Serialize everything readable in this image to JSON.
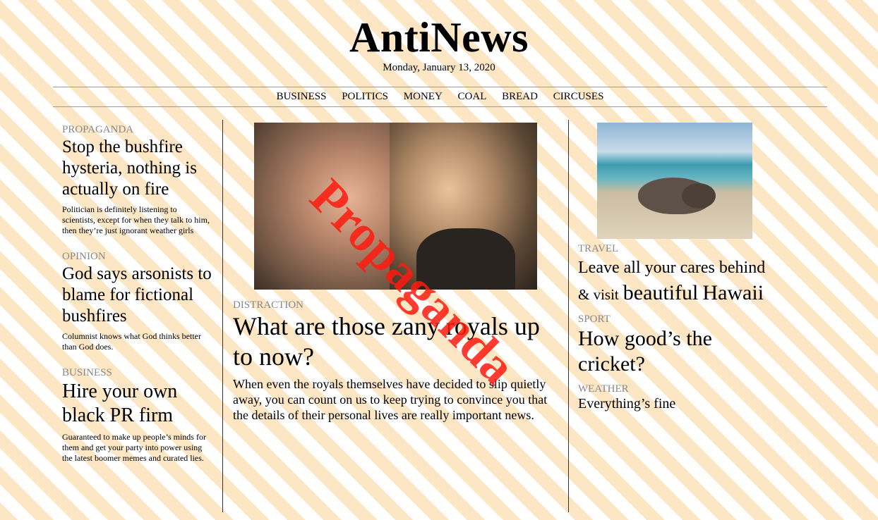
{
  "masthead": {
    "logo": "AntiNews",
    "date": "Monday, January 13, 2020"
  },
  "nav": [
    "BUSINESS",
    "POLITICS",
    "MONEY",
    "COAL",
    "BREAD",
    "CIRCUSES"
  ],
  "left": [
    {
      "section": "PROPAGANDA",
      "headline": "Stop the bushfire hysteria, nothing is actually on fire",
      "blurb": "Politician is definitely listening to scientists, except for when they talk to him, then they’re just ignorant weather girls"
    },
    {
      "section": "OPINION",
      "headline": "God says arsonists to blame for fictional bushfires",
      "blurb": "Columnist knows what God thinks better than God does."
    },
    {
      "section": "BUSINESS",
      "headline": "Hire your own black PR firm",
      "blurb": "Guaranteed to make up people’s minds for them and get your party into power using the latest boomer memes and curated lies."
    }
  ],
  "main": {
    "section": "DISTRACTION",
    "headline": "What are those zany royals up to now?",
    "body": "When even the royals themselves have decided to slip quietly away, you can count on us to keep trying to convince you that the details of their personal lives are really important news."
  },
  "right": {
    "travel": {
      "section": "TRAVEL",
      "part1": "Leave all your cares behind",
      "part2": "& visit",
      "part3": "beautiful",
      "part4": "Hawaii"
    },
    "sport": {
      "section": "SPORT",
      "headline": "How good’s the cricket?"
    },
    "weather": {
      "section": "WEATHER",
      "headline": "Everything’s fine"
    }
  },
  "stamp": "Propaganda"
}
